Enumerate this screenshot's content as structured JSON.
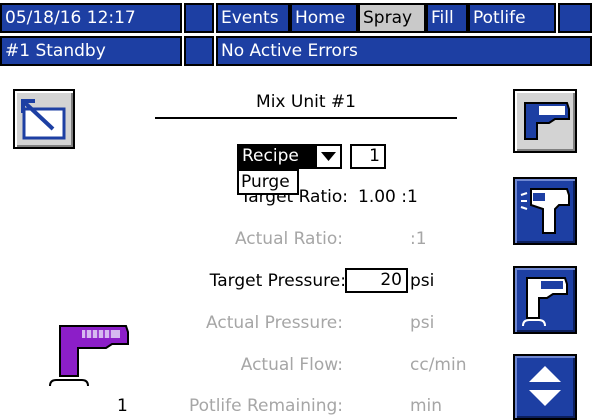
{
  "header": {
    "datetime": "05/18/16 12:17",
    "tabs": [
      {
        "label": "Events",
        "selected": false
      },
      {
        "label": "Home",
        "selected": false
      },
      {
        "label": "Spray",
        "selected": true
      },
      {
        "label": "Fill",
        "selected": false
      },
      {
        "label": "Potlife",
        "selected": false
      }
    ],
    "status": "#1 Standby",
    "errors": "No Active Errors"
  },
  "main": {
    "title": "Mix Unit #1",
    "recipe_dropdown": {
      "selected": "Recipe",
      "options": [
        "Purge"
      ]
    },
    "recipe_number": "1",
    "rows": [
      {
        "label": "Target Ratio:",
        "value": "1.00 :1",
        "enabled": true
      },
      {
        "label": "Actual Ratio:",
        "value": ":1",
        "enabled": false
      },
      {
        "label": "Target Pressure:",
        "value": "20",
        "unit": "psi",
        "enabled": true
      },
      {
        "label": "Actual Pressure:",
        "value": "psi",
        "enabled": false
      },
      {
        "label": "Actual Flow:",
        "value": "cc/min",
        "enabled": false
      },
      {
        "label": "Potlife Remaining:",
        "value": "min",
        "enabled": false
      }
    ],
    "gun_number": "1"
  },
  "colors": {
    "header_blue": "#1d3fa3",
    "selected_tab": "#c9c9c9",
    "disabled_text": "#a6a6a6",
    "gun_purple": "#8c1ec8"
  },
  "icons": {
    "exit": "exit-screen-icon",
    "spray_gun_mode": "spray-gun-mode-icon",
    "spray_gun_purge": "spray-gun-purge-icon",
    "spray_gun_standby": "spray-gun-standby-icon",
    "scroll": "up-down-arrows-icon"
  }
}
